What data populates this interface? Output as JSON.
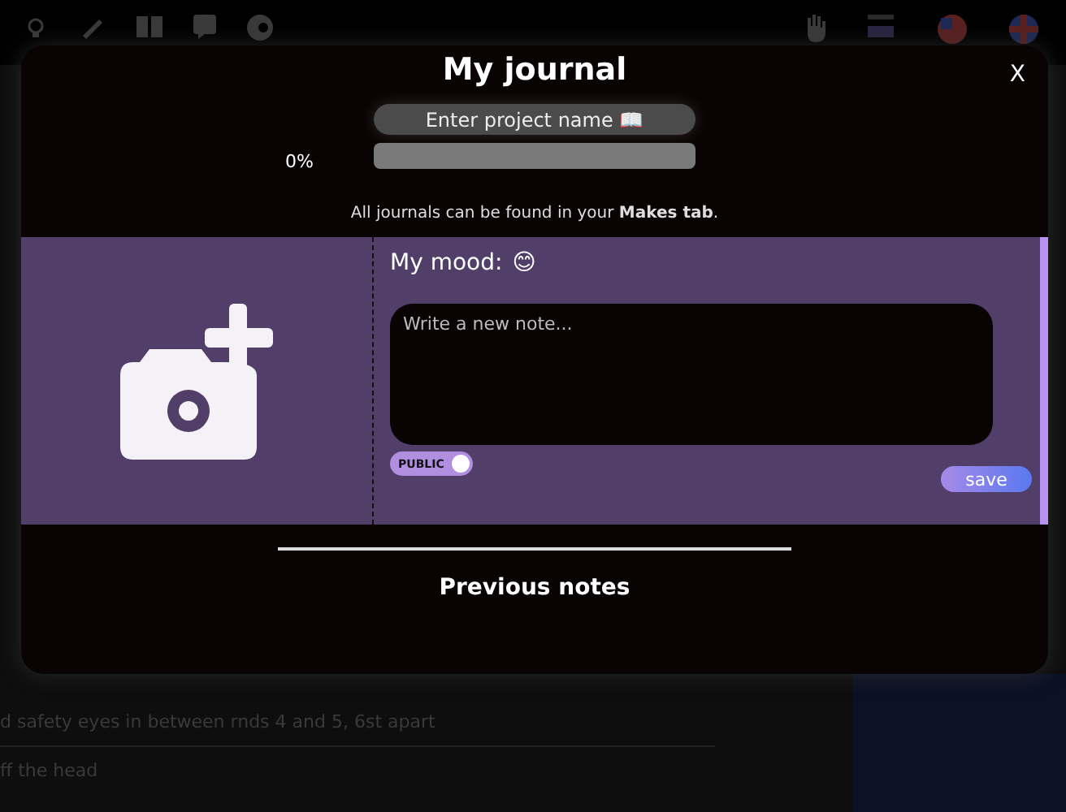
{
  "background": {
    "lines": [
      "d safety eyes in between rnds 4 and 5, 6st apart",
      "ff the head"
    ]
  },
  "modal": {
    "title": "My journal",
    "close": "X",
    "project_name": {
      "placeholder": "Enter project name 📖"
    },
    "progress": {
      "reading": "0%",
      "level": 0
    },
    "info": "All journals can be found in your **Makes tab**.",
    "entry": {
      "mood_label": "My mood:",
      "mood": "😊",
      "note": {
        "placeholder": "Write a new note..."
      },
      "visibility": {
        "label": "PUBLIC",
        "on": true
      },
      "save": "save"
    },
    "previous": "Previous notes"
  }
}
